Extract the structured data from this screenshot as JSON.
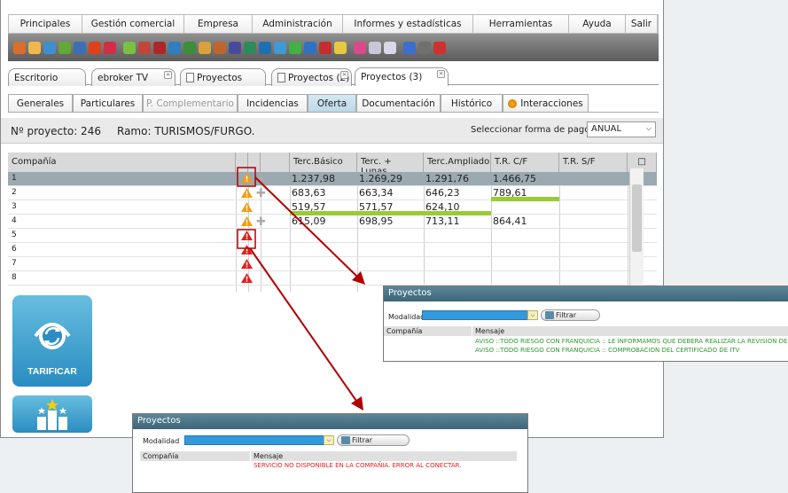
{
  "menu": [
    "Principales",
    "Gestión comercial",
    "Empresa",
    "Administración",
    "Informes y estadísticas",
    "Herramientas",
    "Ayuda",
    "Salir"
  ],
  "toolbar_icons": [
    "users-icon",
    "user-icon",
    "user-add-icon",
    "card-icon",
    "monitor-icon",
    "fire-icon",
    "target-icon",
    "brush-icon",
    "briefcase-icon",
    "bag-icon",
    "car-icon",
    "box-icon",
    "people-icon",
    "people-alt-icon",
    "nodes-icon",
    "chart-icon",
    "gear-icon",
    "diamond-icon",
    "arrows-icon",
    "refresh-icon",
    "g-icon",
    "bulb-icon",
    "id-card-icon",
    "folder-icon",
    "calendar-icon",
    "pen-icon",
    "tools-icon",
    "help-icon"
  ],
  "tabs_top": [
    {
      "label": "Escritorio",
      "closable": false
    },
    {
      "label": "ebroker TV",
      "closable": true
    },
    {
      "label": "Proyectos",
      "closable": false,
      "icon": true
    },
    {
      "label": "Proyectos (2)",
      "closable": true,
      "icon": true
    },
    {
      "label": "Proyectos (3)",
      "closable": true,
      "active": true
    }
  ],
  "tabs_sub": [
    {
      "label": "Generales"
    },
    {
      "label": "Particulares"
    },
    {
      "label": "P. Complementario",
      "disabled": true
    },
    {
      "label": "Incidencias"
    },
    {
      "label": "Oferta",
      "active": true
    },
    {
      "label": "Documentación"
    },
    {
      "label": "Histórico"
    },
    {
      "label": "Interacciones",
      "icon": true
    }
  ],
  "project": {
    "number_label": "Nº proyecto: 246",
    "ramo_label": "Ramo: TURISMOS/FURGO.",
    "payment_label": "Seleccionar forma de pago",
    "payment_value": "ANUAL"
  },
  "grid": {
    "headers": [
      "Compañía",
      "Terc.Básico",
      "Terc. + Lunas",
      "Terc.Ampliado",
      "T.R. C/F",
      "T.R. S/F"
    ],
    "rows": [
      {
        "id": "1",
        "warn": "orange",
        "plus": true,
        "values": [
          "1.237,98",
          "1.269,29",
          "1.291,76",
          "1.466,75",
          ""
        ],
        "green": [],
        "selected": true
      },
      {
        "id": "2",
        "warn": "orange",
        "plus": true,
        "values": [
          "683,63",
          "663,34",
          "646,23",
          "789,61",
          ""
        ],
        "green": [
          3
        ]
      },
      {
        "id": "3",
        "warn": "orange",
        "plus": false,
        "values": [
          "519,57",
          "571,57",
          "624,10",
          "",
          ""
        ],
        "green": [
          0,
          1,
          2
        ]
      },
      {
        "id": "4",
        "warn": "orange",
        "plus": true,
        "values": [
          "615,09",
          "698,95",
          "713,11",
          "864,41",
          ""
        ],
        "green": []
      },
      {
        "id": "5",
        "warn": "red",
        "plus": false,
        "values": [
          "",
          "",
          "",
          "",
          ""
        ],
        "green": []
      },
      {
        "id": "6",
        "warn": "red",
        "plus": false,
        "values": [
          "",
          "",
          "",
          "",
          ""
        ],
        "green": []
      },
      {
        "id": "7",
        "warn": "red",
        "plus": false,
        "values": [
          "",
          "",
          "",
          "",
          ""
        ],
        "green": []
      },
      {
        "id": "8",
        "warn": "red",
        "plus": false,
        "values": [
          "",
          "",
          "",
          "",
          ""
        ],
        "green": []
      }
    ]
  },
  "tarificar_label": "TARIFICAR",
  "popup_warn": {
    "title": "Proyectos",
    "modalidad_label": "Modalidad",
    "filter_label": "Filtrar",
    "col_company": "Compañía",
    "col_message": "Mensaje",
    "messages": [
      "AVISO ::TODO RIESGO CON FRANQUICIA :: LE INFORMAMOS QUE DEBERA REALIZAR LA REVISION DEL",
      "AVISO ::TODO RIESGO CON FRANQUICIA :: COMPROBACION DEL CERTIFICADO DE ITV"
    ],
    "message_color": "#2a9a2a"
  },
  "popup_error": {
    "title": "Proyectos",
    "modalidad_label": "Modalidad",
    "filter_label": "Filtrar",
    "col_company": "Compañía",
    "col_message": "Mensaje",
    "messages": [
      "SERVICIO NO DISPONIBLE EN LA COMPAÑIA. ERROR AL CONECTAR."
    ],
    "message_color": "#e02020"
  },
  "colors": {
    "accent": "#bcd8e8",
    "highlight": "#99cc33",
    "arrow": "#b00000"
  }
}
